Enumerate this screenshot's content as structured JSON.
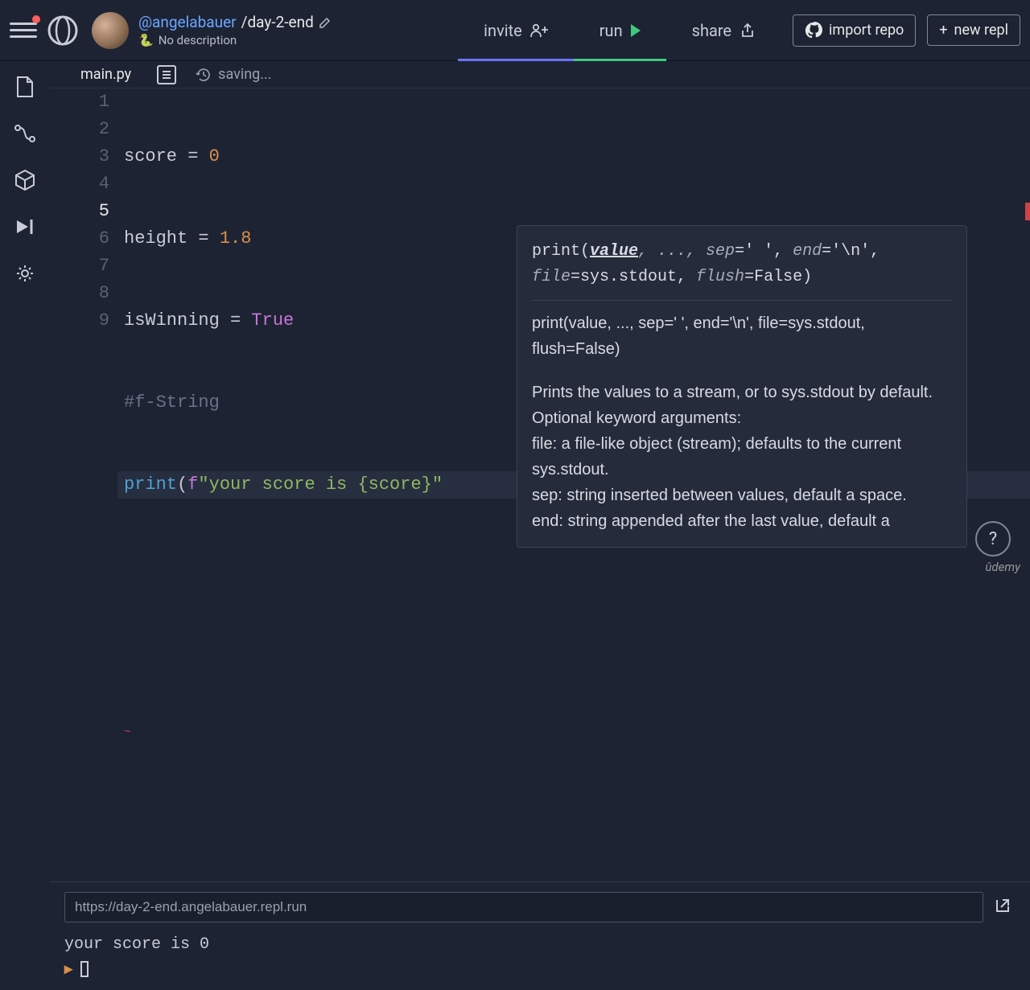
{
  "header": {
    "user": "@angelabauer",
    "separator": "/",
    "project": "day-2-end",
    "description": "No description",
    "invite": "invite",
    "run": "run",
    "share": "share",
    "import_repo": "import repo",
    "new_repl": "new repl"
  },
  "tabs": {
    "file": "main.py",
    "saving": "saving..."
  },
  "code": {
    "lines": [
      "1",
      "2",
      "3",
      "4",
      "5",
      "6",
      "7",
      "8",
      "9"
    ],
    "l1a": "score ",
    "l1b": "=",
    "l1c": " 0",
    "l2a": "height ",
    "l2b": "=",
    "l2c": " 1.8",
    "l3a": "isWinning ",
    "l3b": "=",
    "l3c": " True",
    "l4": "#f-String",
    "l5a": "print",
    "l5b": "(",
    "l5c": "f",
    "l5d": "\"your score is {score}\"",
    "squiggle": "~"
  },
  "tooltip": {
    "sig_prefix": "print(",
    "sig_value": "value",
    "sig_rest1": ", ..., ",
    "sig_sep": "sep",
    "sig_rest2": "=' ', ",
    "sig_end": "end",
    "sig_rest3": "='\\n', ",
    "sig_file": "file",
    "sig_rest4": "=sys.stdout, ",
    "sig_flush": "flush",
    "sig_rest5": "=False)",
    "doc_sig": "print(value, ..., sep=' ', end='\\n', file=sys.stdout, flush=False)",
    "doc_body": "Prints the values to a stream, or to sys.stdout by default.\nOptional keyword arguments:\nfile:  a file-like object (stream); defaults to the current sys.stdout.\nsep:   string inserted between values, default a space.\nend:   string appended after the last value, default a"
  },
  "console": {
    "url": "https://day-2-end.angelabauer.repl.run",
    "output": "your score is 0"
  },
  "footer": {
    "help": "?",
    "brand": "ûdemy"
  }
}
